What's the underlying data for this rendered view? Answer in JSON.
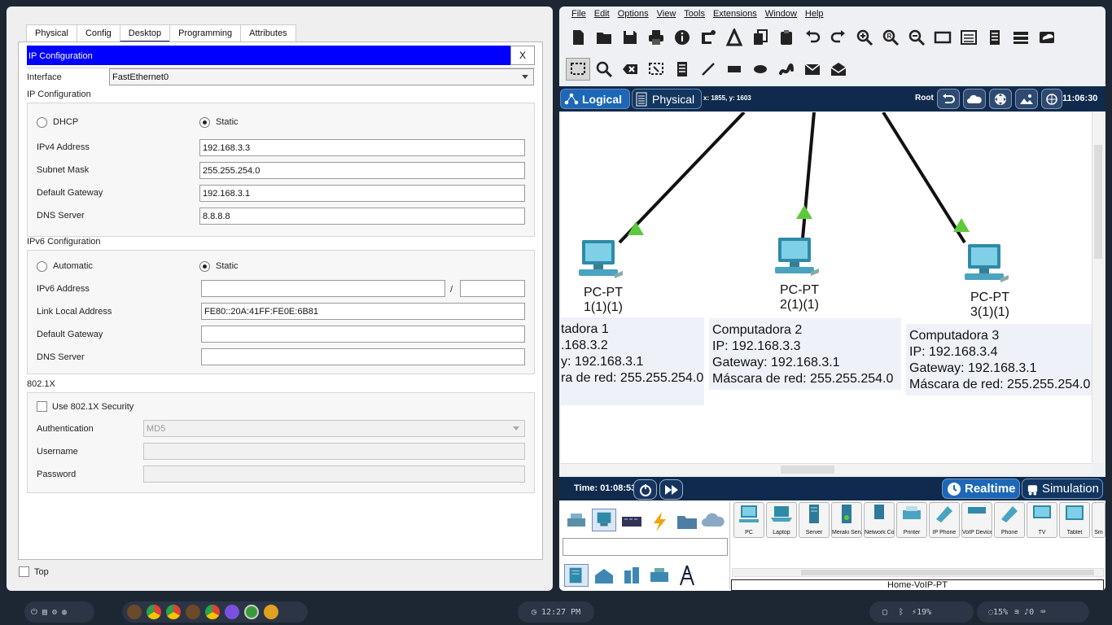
{
  "left_window": {
    "tabs": [
      {
        "label": "Physical"
      },
      {
        "label": "Config"
      },
      {
        "label": "Desktop"
      },
      {
        "label": "Programming"
      },
      {
        "label": "Attributes"
      }
    ],
    "active_tab": "Desktop",
    "ip_config_title": "IP Configuration",
    "close_label": "X",
    "interface_label": "Interface",
    "interface_value": "FastEthernet0",
    "ipv4_section": {
      "title": "IP Configuration",
      "dhcp_label": "DHCP",
      "static_label": "Static",
      "selected": "Static",
      "ipv4_label": "IPv4 Address",
      "ipv4_value": "192.168.3.3",
      "subnet_label": "Subnet Mask",
      "subnet_value": "255.255.254.0",
      "gateway_label": "Default Gateway",
      "gateway_value": "192.168.3.1",
      "dns_label": "DNS Server",
      "dns_value": "8.8.8.8"
    },
    "ipv6_section": {
      "title": "IPv6 Configuration",
      "auto_label": "Automatic",
      "static_label": "Static",
      "selected": "Static",
      "ipv6_label": "IPv6 Address",
      "ipv6_value": "",
      "prefix_separator": "/",
      "prefix_value": "",
      "link_local_label": "Link Local Address",
      "link_local_value": "FE80::20A:41FF:FE0E:6B81",
      "gateway_label": "Default Gateway",
      "gateway_value": "",
      "dns_label": "DNS Server",
      "dns_value": ""
    },
    "dot1x_section": {
      "title": "802.1X",
      "use_label": "Use 802.1X Security",
      "auth_label": "Authentication",
      "auth_value": "MD5",
      "username_label": "Username",
      "username_value": "",
      "password_label": "Password",
      "password_value": ""
    },
    "top_label": "Top"
  },
  "right_window": {
    "menu": [
      "File",
      "Edit",
      "Options",
      "View",
      "Tools",
      "Extensions",
      "Window",
      "Help"
    ],
    "toolbar_main": [
      "new-icon",
      "open-icon",
      "save-icon",
      "print-icon",
      "info-icon",
      "network-wizard-icon",
      "activity-wizard-icon",
      "copy-icon",
      "paste-icon",
      "undo-icon",
      "redo-icon",
      "zoom-in-icon",
      "zoom-reset-icon",
      "zoom-out-icon",
      "drawing-palette-icon",
      "custom-devices-icon",
      "notes-icon",
      "pdu-list-icon",
      "cluster-icon"
    ],
    "toolbar_secondary": [
      "select-icon",
      "inspect-icon",
      "delete-icon",
      "resize-icon",
      "place-note-icon",
      "draw-line-icon",
      "draw-rectangle-icon",
      "draw-ellipse-icon",
      "draw-freeform-icon",
      "add-simple-pdu-icon",
      "add-complex-pdu-icon"
    ],
    "nav": {
      "logical_label": "Logical",
      "physical_label": "Physical",
      "coords": "x: 1855, y: 1603",
      "root_label": "Root",
      "clock": "11:06:30"
    },
    "devices": [
      {
        "type": "PC-PT",
        "name": "1(1)(1)"
      },
      {
        "type": "PC-PT",
        "name": "2(1)(1)"
      },
      {
        "type": "PC-PT",
        "name": "3(1)(1)"
      }
    ],
    "notes": [
      {
        "lines": [
          "tadora 1",
          ".168.3.2",
          "y: 192.168.3.1",
          "ra de red: 255.255.254.0"
        ]
      },
      {
        "lines": [
          "Computadora 2",
          "IP: 192.168.3.3",
          "Gateway: 192.168.3.1",
          "Máscara de red: 255.255.254.0"
        ]
      },
      {
        "lines": [
          "Computadora 3",
          "IP: 192.168.3.4",
          "Gateway: 192.168.3.1",
          "Máscara de red: 255.255.254.0"
        ]
      }
    ],
    "sim": {
      "time_label": "Time: 01:08:53",
      "realtime_label": "Realtime",
      "simulation_label": "Simulation"
    },
    "device_list": [
      "PC",
      "Laptop",
      "Server",
      "Meraki Server",
      "Network Controller",
      "Printer",
      "IP Phone",
      "VoIP Device",
      "Phone",
      "TV",
      "Tablet",
      "Sm"
    ],
    "status_device": "Home-VoIP-PT"
  },
  "taskbar": {
    "time": "12:27 PM",
    "battery": "19%",
    "brightness": "15%",
    "volume": "0"
  },
  "colors": {
    "ip_title_bar": "#0000ff",
    "nav_bar": "#0f2a4d",
    "link_green": "#5cc93a",
    "taskbar": "#1d2633"
  }
}
